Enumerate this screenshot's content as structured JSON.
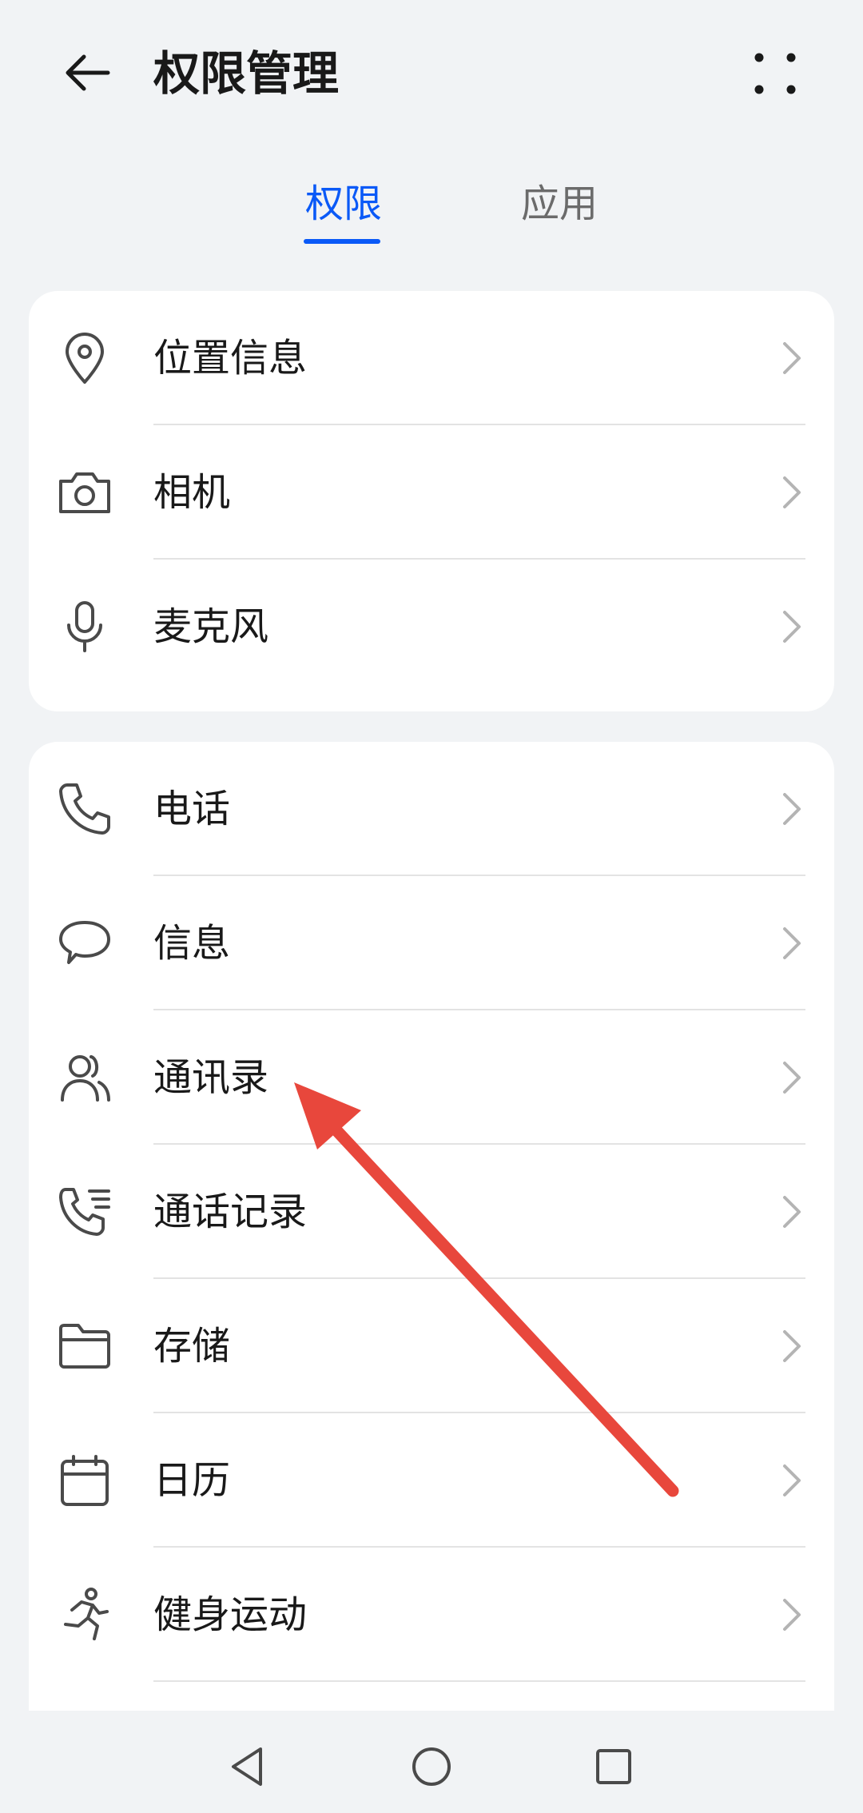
{
  "header": {
    "title": "权限管理",
    "back_icon": "arrow-left-icon",
    "more_icon": "more-dots-icon"
  },
  "tabs": [
    {
      "label": "权限",
      "selected": true
    },
    {
      "label": "应用",
      "selected": false
    }
  ],
  "groups": [
    {
      "items": [
        {
          "label": "位置信息",
          "icon": "location-pin-icon"
        },
        {
          "label": "相机",
          "icon": "camera-icon"
        },
        {
          "label": "麦克风",
          "icon": "microphone-icon"
        }
      ]
    },
    {
      "items": [
        {
          "label": "电话",
          "icon": "phone-icon"
        },
        {
          "label": "信息",
          "icon": "message-bubble-icon"
        },
        {
          "label": "通讯录",
          "icon": "contacts-icon"
        },
        {
          "label": "通话记录",
          "icon": "call-log-icon"
        },
        {
          "label": "存储",
          "icon": "folder-icon"
        },
        {
          "label": "日历",
          "icon": "calendar-icon"
        },
        {
          "label": "健身运动",
          "icon": "running-icon"
        }
      ]
    }
  ],
  "navbar": {
    "back_icon": "nav-back-triangle-icon",
    "home_icon": "nav-home-circle-icon",
    "recent_icon": "nav-recent-square-icon"
  },
  "colors": {
    "accent": "#0a59f7",
    "background": "#f1f3f5",
    "card": "#ffffff",
    "annotation_arrow": "#e8473c"
  }
}
